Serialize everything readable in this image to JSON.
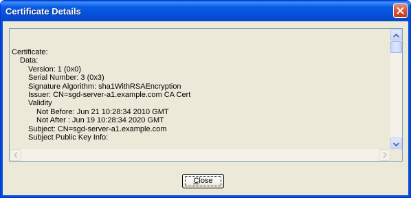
{
  "window": {
    "title": "Certificate Details"
  },
  "certificate_text": {
    "lines": [
      {
        "indent": 0,
        "text": "Certificate:"
      },
      {
        "indent": 1,
        "text": "Data:"
      },
      {
        "indent": 2,
        "text": "Version: 1 (0x0)"
      },
      {
        "indent": 2,
        "text": "Serial Number: 3 (0x3)"
      },
      {
        "indent": 2,
        "text": "Signature Algorithm: sha1WithRSAEncryption"
      },
      {
        "indent": 2,
        "text": "Issuer: CN=sgd-server-a1.example.com CA Cert"
      },
      {
        "indent": 2,
        "text": "Validity"
      },
      {
        "indent": 3,
        "text": "Not Before: Jun 21 10:28:34 2010 GMT"
      },
      {
        "indent": 3,
        "text": "Not After : Jun 19 10:28:34 2020 GMT"
      },
      {
        "indent": 2,
        "text": "Subject: CN=sgd-server-a1.example.com"
      },
      {
        "indent": 2,
        "text": "Subject Public Key Info:"
      }
    ]
  },
  "buttons": {
    "close_first": "C",
    "close_rest": "lose"
  },
  "colors": {
    "titlebar": "#0551d9",
    "dialog_bg": "#ece9d8",
    "close_icon_bg": "#d8583a"
  },
  "icons": {
    "close": "close-x-icon",
    "scroll_up": "arrow-up-icon",
    "scroll_down": "arrow-down-icon",
    "scroll_left": "arrow-left-icon",
    "scroll_right": "arrow-right-icon"
  }
}
